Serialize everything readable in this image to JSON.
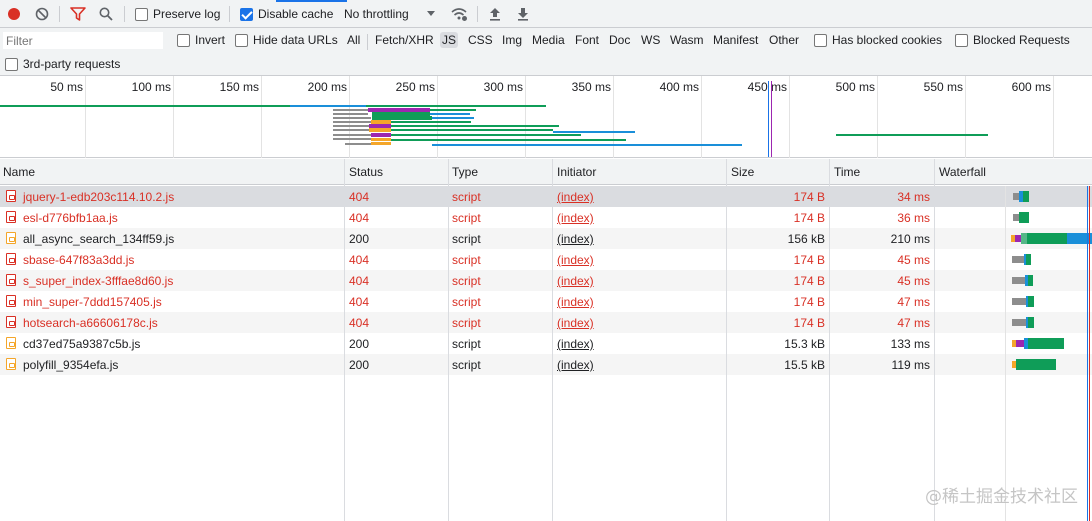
{
  "toolbar": {
    "record_icon": "record-icon",
    "clear_icon": "clear-icon",
    "filter_icon": "filter-icon",
    "search_icon": "search-icon",
    "preserve_log": {
      "label": "Preserve log",
      "checked": false
    },
    "disable_cache": {
      "label": "Disable cache",
      "checked": true
    },
    "throttling": "No throttling",
    "network_conditions_icon": "wifi-gear-icon",
    "import_icon": "upload-icon",
    "export_icon": "download-icon"
  },
  "filterbar": {
    "placeholder": "Filter",
    "invert": "Invert",
    "hide_data_urls": "Hide data URLs",
    "types": [
      "All",
      "Fetch/XHR",
      "JS",
      "CSS",
      "Img",
      "Media",
      "Font",
      "Doc",
      "WS",
      "Wasm",
      "Manifest",
      "Other"
    ],
    "selected_type": "JS",
    "has_blocked_cookies": "Has blocked cookies",
    "blocked_requests": "Blocked Requests",
    "third_party": "3rd-party requests"
  },
  "overview": {
    "ticks": [
      "50 ms",
      "100 ms",
      "150 ms",
      "200 ms",
      "250 ms",
      "300 ms",
      "350 ms",
      "400 ms",
      "450 ms",
      "500 ms",
      "550 ms",
      "600 ms"
    ]
  },
  "columns": [
    "Name",
    "Status",
    "Type",
    "Initiator",
    "Size",
    "Time",
    "Waterfall"
  ],
  "rows": [
    {
      "name": "jquery-1-edb203c114.10.2.js",
      "status": "404",
      "type": "script",
      "initiator": "(index)",
      "size": "174 B",
      "time": "34 ms",
      "error": true
    },
    {
      "name": "esl-d776bfb1aa.js",
      "status": "404",
      "type": "script",
      "initiator": "(index)",
      "size": "174 B",
      "time": "36 ms",
      "error": true
    },
    {
      "name": "all_async_search_134ff59.js",
      "status": "200",
      "type": "script",
      "initiator": "(index)",
      "size": "156 kB",
      "time": "210 ms",
      "error": false
    },
    {
      "name": "sbase-647f83a3dd.js",
      "status": "404",
      "type": "script",
      "initiator": "(index)",
      "size": "174 B",
      "time": "45 ms",
      "error": true
    },
    {
      "name": "s_super_index-3fffae8d60.js",
      "status": "404",
      "type": "script",
      "initiator": "(index)",
      "size": "174 B",
      "time": "45 ms",
      "error": true
    },
    {
      "name": "min_super-7ddd157405.js",
      "status": "404",
      "type": "script",
      "initiator": "(index)",
      "size": "174 B",
      "time": "47 ms",
      "error": true
    },
    {
      "name": "hotsearch-a66606178c.js",
      "status": "404",
      "type": "script",
      "initiator": "(index)",
      "size": "174 B",
      "time": "47 ms",
      "error": true
    },
    {
      "name": "cd37ed75a9387c5b.js",
      "status": "200",
      "type": "script",
      "initiator": "(index)",
      "size": "15.3 kB",
      "time": "133 ms",
      "error": false
    },
    {
      "name": "polyfill_9354efa.js",
      "status": "200",
      "type": "script",
      "initiator": "(index)",
      "size": "15.5 kB",
      "time": "119 ms",
      "error": false
    }
  ],
  "watermark": "@稀土掘金技术社区",
  "colors": {
    "accent": "#1a73e8",
    "error": "#d93025",
    "record": "#d93025",
    "wf_green": "#0f9d58",
    "wf_blue": "#1a8fd9",
    "wf_gray": "#8d8d8d",
    "wf_purple": "#9c27b0",
    "wf_orange": "#f4a62a"
  }
}
